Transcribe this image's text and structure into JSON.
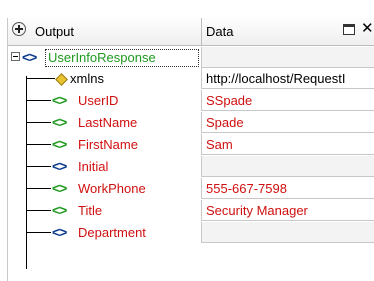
{
  "header": {
    "col_output": "Output",
    "col_data": "Data",
    "close_glyph": "✕"
  },
  "root": {
    "name": "UserInfoResponse"
  },
  "rows": [
    {
      "label": "xmlns",
      "value": "http://localhost/RequestI",
      "icon": "attribute-diamond-icon",
      "color": "#000000"
    },
    {
      "label": "UserID",
      "value": "SSpade",
      "icon": "element-green-icon",
      "color": "#d01010"
    },
    {
      "label": "LastName",
      "value": "Spade",
      "icon": "element-green-icon",
      "color": "#d01010"
    },
    {
      "label": "FirstName",
      "value": "Sam",
      "icon": "element-green-icon",
      "color": "#d01010"
    },
    {
      "label": "Initial",
      "value": "",
      "icon": "element-blue-icon",
      "color": "#d01010"
    },
    {
      "label": "WorkPhone",
      "value": "555-667-7598",
      "icon": "element-green-icon",
      "color": "#d01010"
    },
    {
      "label": "Title",
      "value": "Security Manager",
      "icon": "element-green-icon",
      "color": "#d01010"
    },
    {
      "label": "Department",
      "value": "",
      "icon": "element-blue-icon",
      "color": "#d01010"
    }
  ],
  "colors": {
    "green_tag": "#1f9a1f",
    "blue_tag": "#0a3a8c",
    "required_text": "#d01010"
  }
}
